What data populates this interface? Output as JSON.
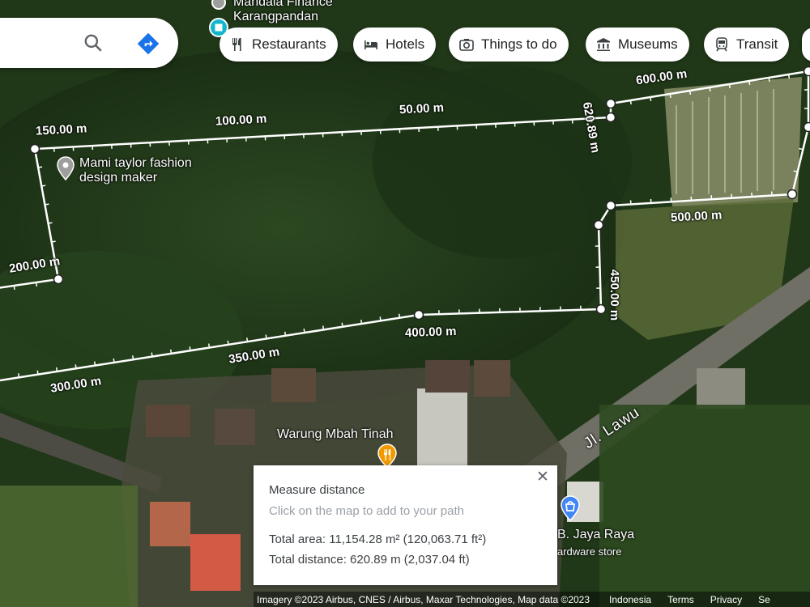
{
  "search": {
    "search_icon": "search-icon",
    "directions_icon": "directions-icon"
  },
  "chips": [
    {
      "label": "Restaurants",
      "icon": "fork-knife-icon"
    },
    {
      "label": "Hotels",
      "icon": "bed-icon"
    },
    {
      "label": "Things to do",
      "icon": "camera-icon"
    },
    {
      "label": "Museums",
      "icon": "museum-icon"
    },
    {
      "label": "Transit",
      "icon": "train-icon"
    }
  ],
  "places": {
    "top": "Mandala Finance\nKarangpandan",
    "mami": "Mami taylor fashion\ndesign maker",
    "warung": "Warung Mbah Tinah",
    "jaya": "B. Jaya Raya",
    "jaya_sub": "ardware store",
    "road": "Jl. Lawu"
  },
  "measure_labels": [
    "600.00 m",
    "50.00 m",
    "100.00 m",
    "150.00 m",
    "620.89 m",
    "500.00 m",
    "450.00 m",
    "400.00 m",
    "350.00 m",
    "300.00 m",
    "200.00 m"
  ],
  "measure_panel": {
    "title": "Measure distance",
    "hint": "Click on the map to add to your path",
    "total_area": "Total area: 11,154.28 m² (120,063.71 ft²)",
    "total_distance": "Total distance: 620.89 m (2,037.04 ft)",
    "close_icon": "close-icon"
  },
  "footer": {
    "imagery": "Imagery ©2023 Airbus, CNES / Airbus, Maxar Technologies, Map data ©2023",
    "country": "Indonesia",
    "terms": "Terms",
    "privacy": "Privacy",
    "send": "Se"
  },
  "colors": {
    "path": "#ffffff",
    "pin_grey": "#9e9e9e",
    "pin_orange": "#f29900",
    "pin_blue": "#4285f4"
  }
}
